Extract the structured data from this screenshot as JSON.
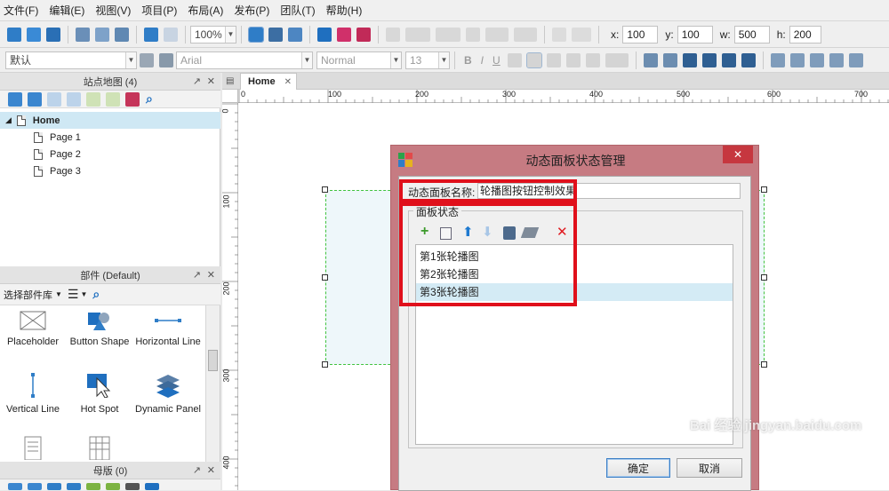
{
  "menu": [
    "文件(F)",
    "编辑(E)",
    "视图(V)",
    "项目(P)",
    "布局(A)",
    "发布(P)",
    "团队(T)",
    "帮助(H)"
  ],
  "toolbar": {
    "zoom": "100%",
    "x_label": "x:",
    "x_value": "100",
    "y_label": "y:",
    "y_value": "100",
    "w_label": "w:",
    "w_value": "500",
    "h_label": "h:",
    "h_value": "200",
    "style_select": "默认",
    "font_select": "Arial",
    "weight_select": "Normal",
    "size_select": "13"
  },
  "sitemap": {
    "title": "站点地图 (4)",
    "home": "Home",
    "pages": [
      "Page 1",
      "Page 2",
      "Page 3"
    ]
  },
  "widgets": {
    "title": "部件 (Default)",
    "library_select": "选择部件库",
    "items": [
      "Placeholder",
      "Button Shape",
      "Horizontal Line",
      "Vertical Line",
      "Hot Spot",
      "Dynamic Panel"
    ]
  },
  "masters": {
    "title": "母版 (0)"
  },
  "canvas": {
    "tab": "Home",
    "hruler_ticks": [
      "0",
      "100",
      "200",
      "300",
      "400",
      "500",
      "600",
      "700"
    ],
    "vruler_ticks": [
      "0",
      "100",
      "200",
      "300",
      "400"
    ]
  },
  "dialog": {
    "title": "动态面板状态管理",
    "name_label": "动态面板名称:",
    "name_value": "轮播图按钮控制效果",
    "states_label": "面板状态",
    "states": [
      "第1张轮播图",
      "第2张轮播图",
      "第3张轮播图"
    ],
    "ok": "确定",
    "cancel": "取消",
    "close": "✕"
  },
  "watermark": "Bai 经验 jingyan.baidu.com",
  "colors": {
    "accent": "#c67b82",
    "highlight": "#d4ebf5",
    "redbox": "#e0101b",
    "selection": "#cfe8f4"
  }
}
